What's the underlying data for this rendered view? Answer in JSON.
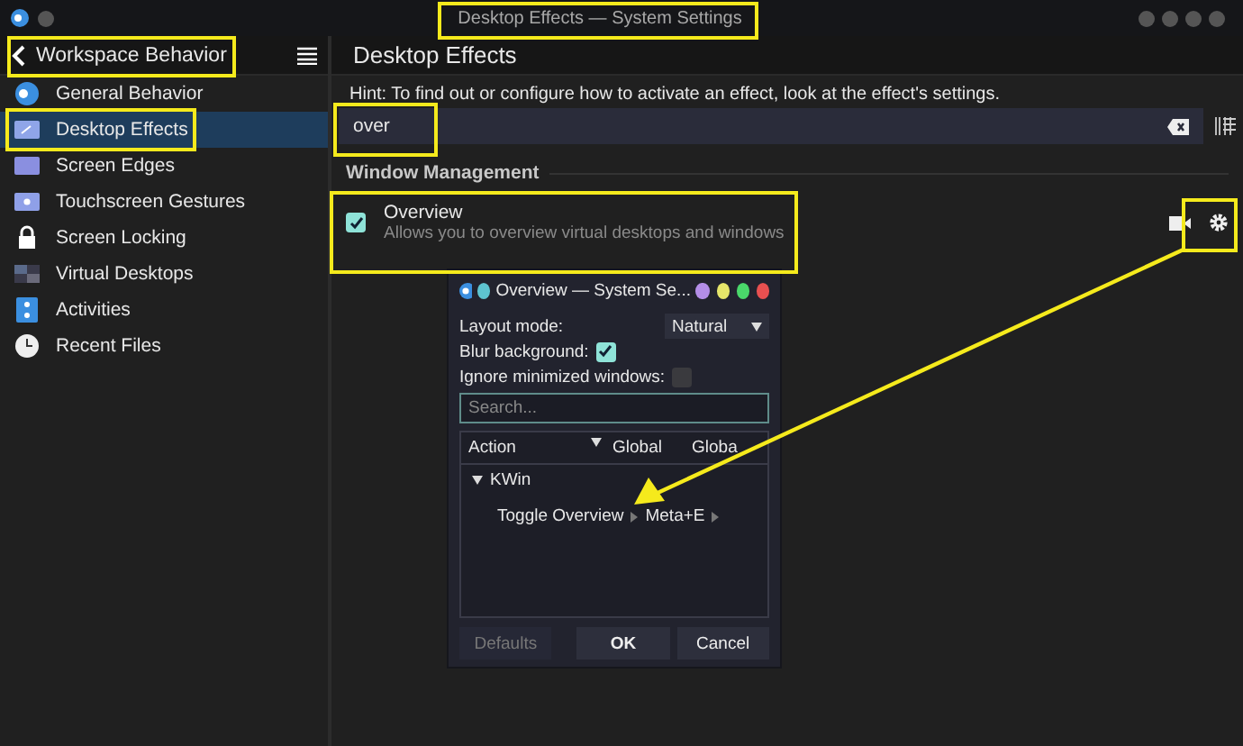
{
  "window": {
    "title": "Desktop Effects — System Settings"
  },
  "sidebar": {
    "title": "Workspace Behavior",
    "items": [
      {
        "label": "General Behavior",
        "selected": false
      },
      {
        "label": "Desktop Effects",
        "selected": true
      },
      {
        "label": "Screen Edges",
        "selected": false
      },
      {
        "label": "Touchscreen Gestures",
        "selected": false
      },
      {
        "label": "Screen Locking",
        "selected": false
      },
      {
        "label": "Virtual Desktops",
        "selected": false
      },
      {
        "label": "Activities",
        "selected": false
      },
      {
        "label": "Recent Files",
        "selected": false
      }
    ]
  },
  "page": {
    "title": "Desktop Effects",
    "hint": "Hint: To find out or configure how to activate an effect, look at the effect's settings.",
    "search": {
      "value": "over"
    },
    "section": "Window Management",
    "effect": {
      "name": "Overview",
      "description": "Allows you to overview virtual desktops and windows",
      "checked": true
    }
  },
  "dialog": {
    "title": "Overview — System Se...",
    "layout_label": "Layout mode:",
    "layout_value": "Natural",
    "blur_label": "Blur background:",
    "blur_checked": true,
    "ignore_label": "Ignore minimized windows:",
    "ignore_checked": false,
    "search": {
      "placeholder": "Search..."
    },
    "columns": [
      "Action",
      "Global",
      "Globa"
    ],
    "tree": [
      {
        "label": "KWin",
        "expanded": true,
        "children": [
          {
            "label": "Toggle Overview",
            "shortcut": "Meta+E"
          }
        ]
      }
    ],
    "buttons": [
      {
        "label": "Defaults",
        "disabled": true
      },
      {
        "label": "OK",
        "disabled": false
      },
      {
        "label": "Cancel",
        "disabled": false
      }
    ]
  }
}
